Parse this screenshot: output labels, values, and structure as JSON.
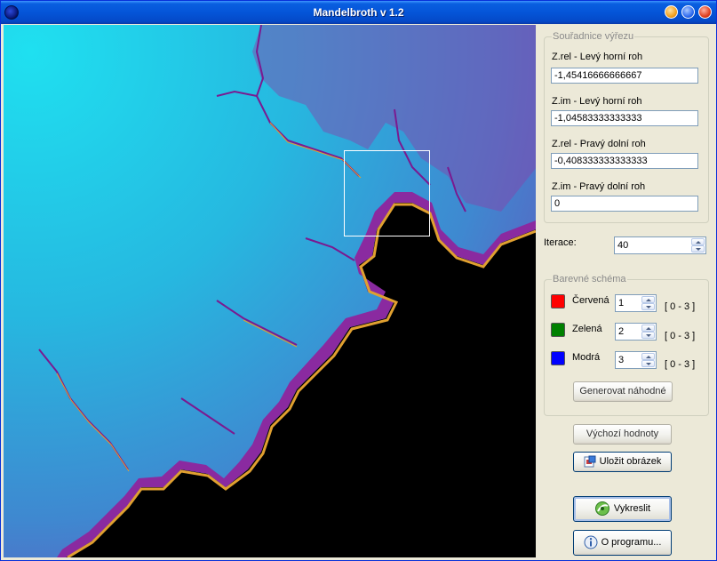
{
  "window": {
    "title": "Mandelbroth v 1.2"
  },
  "coords": {
    "group_title": "Souřadnice výřezu",
    "fields": [
      {
        "label": "Z.rel - Levý horní roh",
        "value": "-1,45416666666667"
      },
      {
        "label": "Z.im - Levý horní roh",
        "value": "-1,04583333333333"
      },
      {
        "label": "Z.rel - Pravý dolní roh",
        "value": "-0,408333333333333"
      },
      {
        "label": "Z.im - Pravý dolní roh",
        "value": "0"
      }
    ]
  },
  "iterations": {
    "label": "Iterace:",
    "value": "40"
  },
  "color_scheme": {
    "group_title": "Barevné schéma",
    "channels": [
      {
        "label": "Červená",
        "value": "1",
        "range": "[ 0 - 3 ]",
        "color": "#ff0000"
      },
      {
        "label": "Zelená",
        "value": "2",
        "range": "[ 0 - 3 ]",
        "color": "#008000"
      },
      {
        "label": "Modrá",
        "value": "3",
        "range": "[ 0 - 3 ]",
        "color": "#0000ff"
      }
    ],
    "random_button": "Generovat náhodné"
  },
  "buttons": {
    "defaults": "Výchozí hodnoty",
    "save": "Uložit obrázek",
    "draw": "Vykreslit",
    "about": "O programu..."
  },
  "icons": {
    "app": "mandelbrot-app-icon",
    "save": "save-image-icon",
    "draw": "render-icon",
    "about": "info-icon"
  }
}
